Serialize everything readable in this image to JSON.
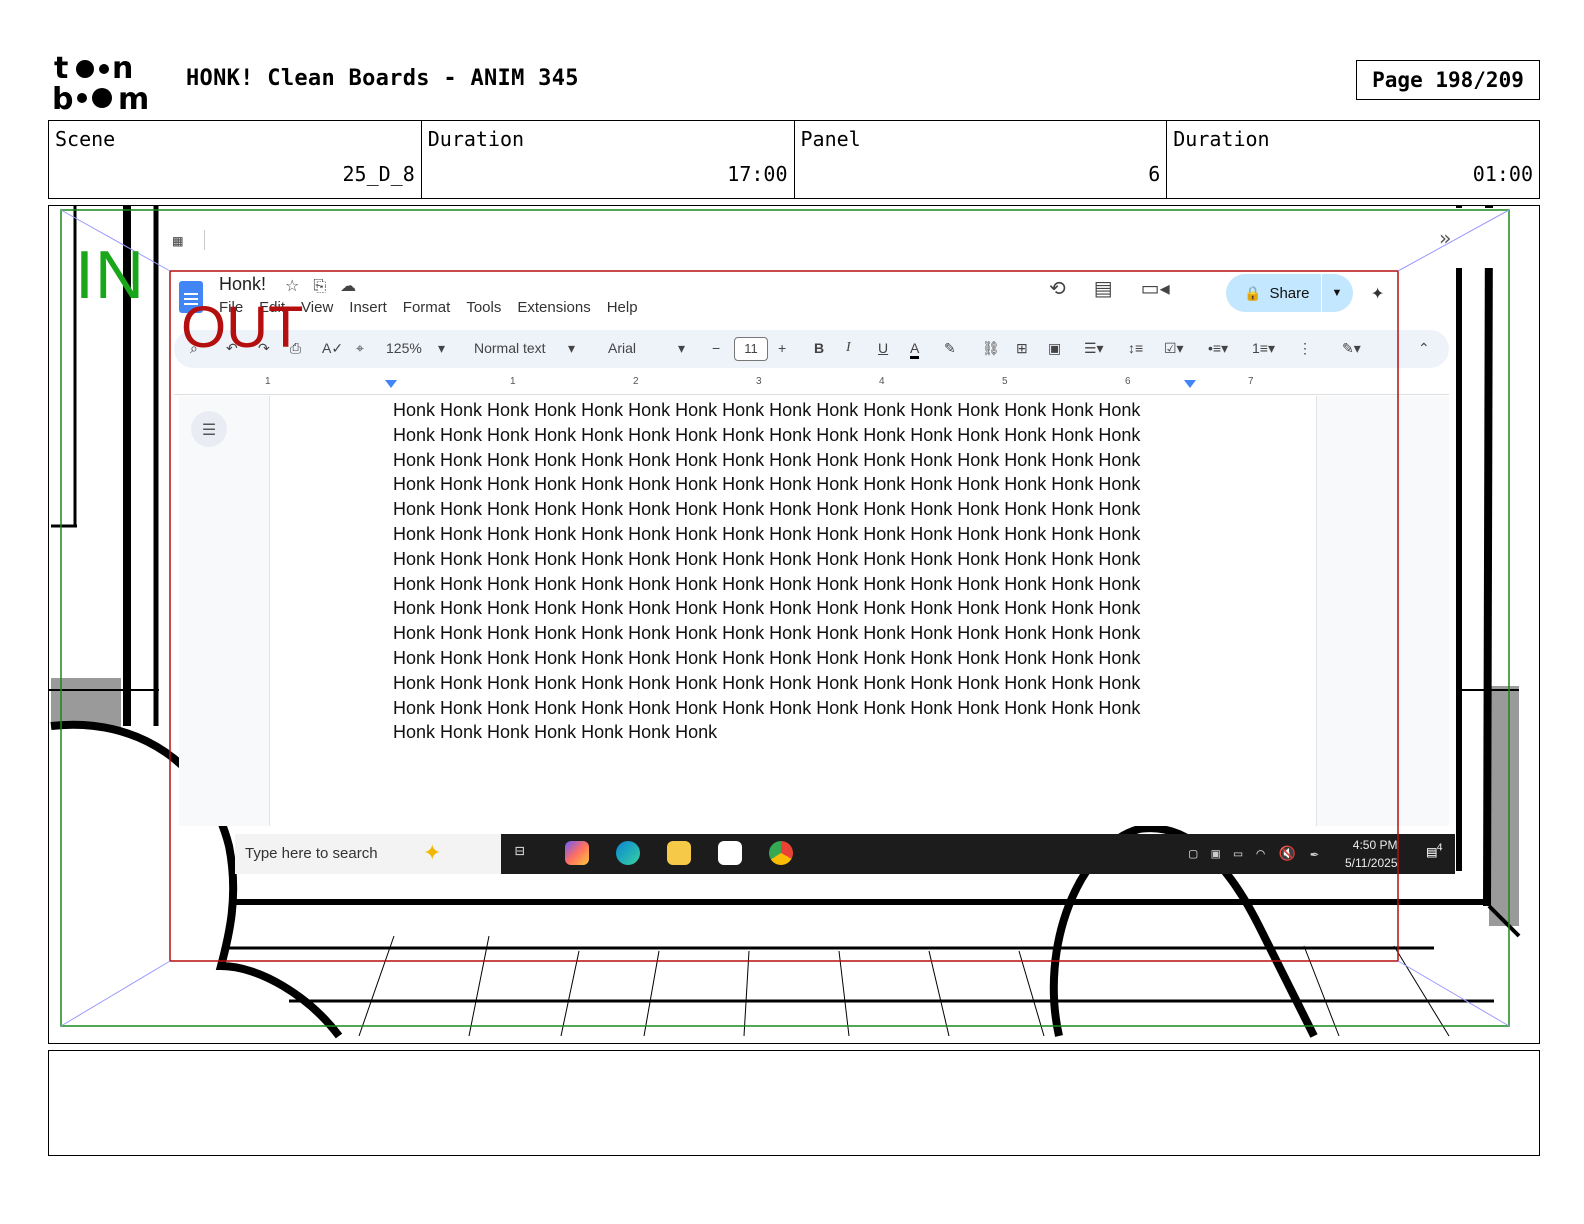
{
  "header": {
    "logo_text": "toonboom",
    "title": "HONK! Clean Boards - ANIM 345",
    "page": "Page 198/209"
  },
  "info": {
    "scene_label": "Scene",
    "scene_value": "25_D_8",
    "duration_label": "Duration",
    "duration_value": "17:00",
    "panel_label": "Panel",
    "panel_value": "6",
    "panel_duration_label": "Duration",
    "panel_duration_value": "01:00"
  },
  "frame_labels": {
    "in": "IN",
    "out": "OUT"
  },
  "docs": {
    "title": "Honk!",
    "menu": [
      "File",
      "Edit",
      "View",
      "Insert",
      "Format",
      "Tools",
      "Extensions",
      "Help"
    ],
    "share_label": "Share",
    "toolbar": {
      "zoom": "125%",
      "style": "Normal text",
      "font": "Arial",
      "font_size": "11"
    },
    "ruler_numbers": [
      "1",
      "1",
      "2",
      "3",
      "4",
      "5",
      "6",
      "7"
    ],
    "body_text": "Honk Honk Honk Honk Honk Honk Honk Honk Honk Honk Honk Honk Honk Honk Honk Honk\nHonk Honk Honk Honk Honk Honk Honk Honk Honk Honk Honk Honk Honk Honk Honk Honk\nHonk Honk Honk Honk Honk Honk Honk Honk Honk Honk Honk Honk Honk Honk Honk Honk\nHonk Honk Honk Honk Honk Honk Honk Honk Honk Honk Honk Honk Honk Honk Honk Honk\nHonk Honk Honk Honk Honk Honk Honk Honk Honk Honk Honk Honk Honk Honk Honk Honk\nHonk Honk Honk Honk Honk Honk Honk Honk Honk Honk Honk Honk Honk Honk Honk Honk\nHonk Honk Honk Honk Honk Honk Honk Honk Honk Honk Honk Honk Honk Honk Honk Honk\nHonk Honk Honk Honk Honk Honk Honk Honk Honk Honk Honk Honk Honk Honk Honk Honk\nHonk Honk Honk Honk Honk Honk Honk Honk Honk Honk Honk Honk Honk Honk Honk Honk\nHonk Honk Honk Honk Honk Honk Honk Honk Honk Honk Honk Honk Honk Honk Honk Honk\nHonk Honk Honk Honk Honk Honk Honk Honk Honk Honk Honk Honk Honk Honk Honk Honk\nHonk Honk Honk Honk Honk Honk Honk Honk Honk Honk Honk Honk Honk Honk Honk Honk\nHonk Honk Honk Honk Honk Honk Honk Honk Honk Honk Honk Honk Honk Honk Honk Honk\nHonk Honk Honk Honk Honk Honk Honk"
  },
  "taskbar": {
    "search_placeholder": "Type here to search",
    "time": "4:50 PM",
    "date": "5/11/2025",
    "notification_count": "4"
  },
  "colors": {
    "in_frame": "#1a8a1a",
    "out_frame": "#b50e0e",
    "share_bg": "#c2e7ff"
  }
}
